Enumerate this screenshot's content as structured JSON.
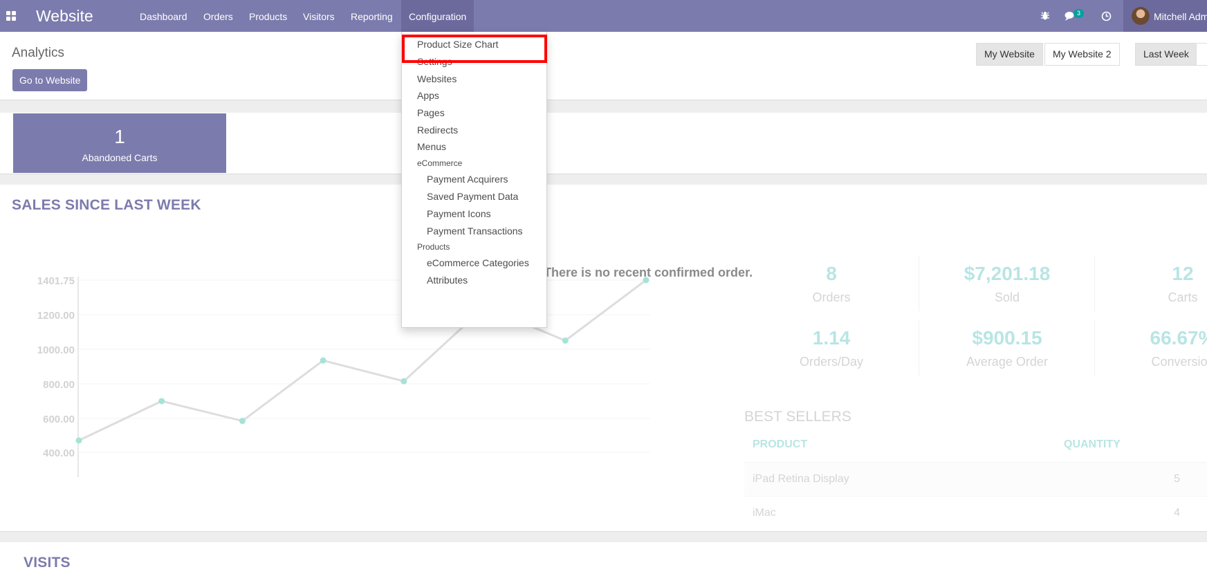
{
  "navbar": {
    "brand": "Website",
    "menu": [
      "Dashboard",
      "Orders",
      "Products",
      "Visitors",
      "Reporting",
      "Configuration"
    ],
    "active_menu": "Configuration",
    "messages_count": "3",
    "user_name": "Mitchell Admin",
    "icons": [
      "apps-grid-icon",
      "bug-icon",
      "chat-bubbles-icon",
      "clock-icon"
    ]
  },
  "control_panel": {
    "title": "Analytics",
    "go_button": "Go to Website",
    "websites": [
      "My Website",
      "My Website 2"
    ],
    "selected_website": "My Website",
    "periods": [
      "Last Week"
    ],
    "selected_period": "Last Week"
  },
  "kpis": [
    {
      "value": "1",
      "label": "Abandoned Carts"
    }
  ],
  "sales": {
    "title": "SALES SINCE LAST WEEK",
    "empty_message": "There is no recent confirmed order.",
    "stats": [
      {
        "value": "8",
        "label": "Orders"
      },
      {
        "value": "$7,201.18",
        "label": "Sold"
      },
      {
        "value": "12",
        "label": "Carts"
      },
      {
        "value": "1.14",
        "label": "Orders/Day"
      },
      {
        "value": "$900.15",
        "label": "Average Order"
      },
      {
        "value": "66.67%",
        "label": "Conversion"
      }
    ],
    "best_sellers": {
      "title": "BEST SELLERS",
      "columns": [
        "PRODUCT",
        "QUANTITY"
      ],
      "rows": [
        {
          "product": "iPad Retina Display",
          "quantity": "5"
        },
        {
          "product": "iMac",
          "quantity": "4"
        }
      ]
    }
  },
  "chart_data": {
    "type": "line",
    "title": "",
    "xlabel": "",
    "ylabel": "",
    "y_ticks": [
      "1401.75",
      "1200.00",
      "1000.00",
      "800.00",
      "600.00",
      "400.00"
    ],
    "ylim": [
      0,
      1401.75
    ],
    "x": [
      1,
      2,
      3,
      4,
      5,
      6,
      7,
      8
    ],
    "values": [
      470,
      700,
      585,
      935,
      815,
      1245,
      1050,
      1401.75
    ],
    "grid": true,
    "legend": "none",
    "line_color": "#dddddd",
    "point_color": "#a6e3d7"
  },
  "visits": {
    "title": "VISITS"
  },
  "dropdown": {
    "highlighted": "Product Size Chart",
    "items": [
      {
        "type": "item",
        "label": "Product Size Chart"
      },
      {
        "type": "item",
        "label": "Settings"
      },
      {
        "type": "item",
        "label": "Websites"
      },
      {
        "type": "item",
        "label": "Apps"
      },
      {
        "type": "item",
        "label": "Pages"
      },
      {
        "type": "item",
        "label": "Redirects"
      },
      {
        "type": "item",
        "label": "Menus"
      },
      {
        "type": "header",
        "label": "eCommerce"
      },
      {
        "type": "sub",
        "label": "Payment Acquirers"
      },
      {
        "type": "sub",
        "label": "Saved Payment Data"
      },
      {
        "type": "sub",
        "label": "Payment Icons"
      },
      {
        "type": "sub",
        "label": "Payment Transactions"
      },
      {
        "type": "header",
        "label": "Products"
      },
      {
        "type": "sub",
        "label": "eCommerce Categories"
      },
      {
        "type": "sub",
        "label": "Attributes"
      }
    ]
  }
}
